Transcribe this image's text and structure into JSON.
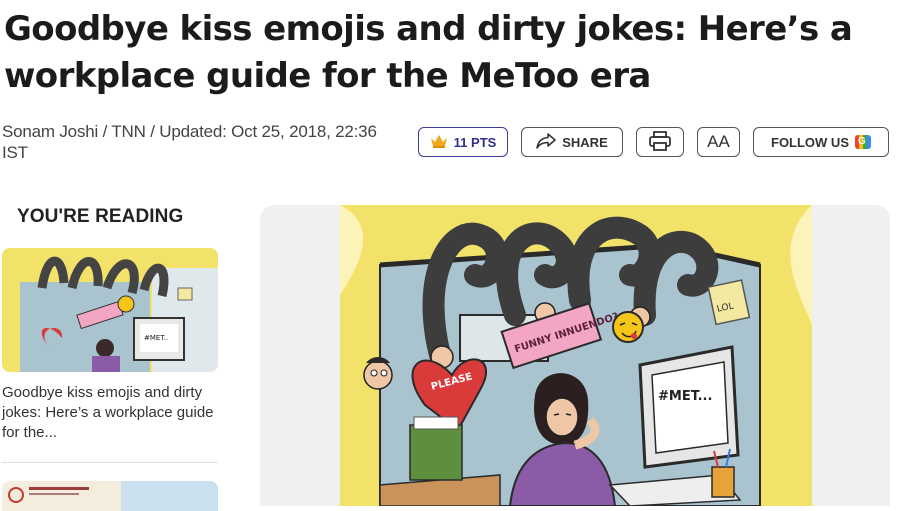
{
  "article": {
    "title": "Goodbye kiss emojis and dirty jokes: Here’s a workplace guide for the MeToo era",
    "byline": "Sonam Joshi / TNN / Updated: Oct 25, 2018, 22:36 IST"
  },
  "actions": {
    "points_label": "11 PTS",
    "share_label": "SHARE",
    "aa_label": "AA",
    "follow_label": "FOLLOW US"
  },
  "sidebar": {
    "heading": "YOU'RE READING",
    "current_caption": "Goodbye kiss emojis and dirty jokes: Here’s a workplace guide for the..."
  },
  "cartoon": {
    "sign_text": "FUNNY INNUENDO?",
    "heart_text": "PLEASE",
    "monitor_text": "#MET...",
    "note_text": "LOL"
  },
  "colors": {
    "accent": "#3b3d9e",
    "wall_yellow": "#f3e26a",
    "cubicle_blue": "#a9c4cf",
    "shirt_purple": "#8c5ba8",
    "heart_red": "#d93b3b",
    "sign_pink": "#f2a6c3"
  },
  "icons": [
    "crown-icon",
    "share-icon",
    "print-icon",
    "google-news-icon"
  ]
}
